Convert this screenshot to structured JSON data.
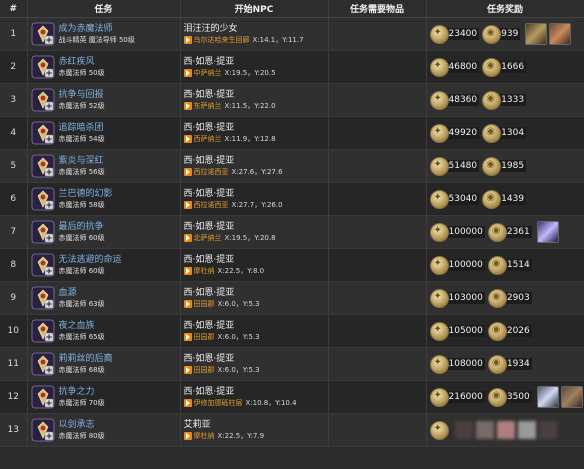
{
  "headers": {
    "num": "#",
    "quest": "任务",
    "npc": "开始NPC",
    "items": "任务需要物品",
    "rewards": "任务奖励"
  },
  "rows": [
    {
      "num": "1",
      "name": "成为赤魔法师",
      "sub": "战斗精英 魔法导师 50级",
      "npc": "泪汪汪的少女",
      "zone": "乌尔达哈来生回廊",
      "coords": "X:14.1，Y:11.7",
      "exp": "23400",
      "gil": "939",
      "items": [
        "a",
        "b"
      ]
    },
    {
      "num": "2",
      "name": "赤红疾风",
      "sub": "赤魔法师 50级",
      "npc": "西·如恩·提亚",
      "zone": "中萨纳兰",
      "coords": "X:19.5，Y:20.5",
      "exp": "46800",
      "gil": "1666",
      "items": []
    },
    {
      "num": "3",
      "name": "抗争与回报",
      "sub": "赤魔法师 52级",
      "npc": "西·如恩·提亚",
      "zone": "东萨纳兰",
      "coords": "X:11.5，Y:22.0",
      "exp": "48360",
      "gil": "1333",
      "items": []
    },
    {
      "num": "4",
      "name": "追踪暗杀团",
      "sub": "赤魔法师 54级",
      "npc": "西·如恩·提亚",
      "zone": "西萨纳兰",
      "coords": "X:11.9，Y:12.8",
      "exp": "49920",
      "gil": "1304",
      "items": []
    },
    {
      "num": "5",
      "name": "紫炎与深红",
      "sub": "赤魔法师 56级",
      "npc": "西·如恩·提亚",
      "zone": "西拉诺西亚",
      "coords": "X:27.6，Y:27.6",
      "exp": "51480",
      "gil": "1985",
      "items": []
    },
    {
      "num": "6",
      "name": "兰巴德的幻影",
      "sub": "赤魔法师 58级",
      "npc": "西·如恩·提亚",
      "zone": "西拉诺西亚",
      "coords": "X:27.7，Y:26.0",
      "exp": "53040",
      "gil": "1439",
      "items": []
    },
    {
      "num": "7",
      "name": "最后的抗争",
      "sub": "赤魔法师 60级",
      "npc": "西·如恩·提亚",
      "zone": "北萨纳兰",
      "coords": "X:19.5，Y:20.8",
      "exp": "100000",
      "gil": "2361",
      "items": [
        "c"
      ]
    },
    {
      "num": "8",
      "name": "无法逃避的命运",
      "sub": "赤魔法师 60级",
      "npc": "西·如恩·提亚",
      "zone": "摩杜纳",
      "coords": "X:22.5，Y:8.0",
      "exp": "100000",
      "gil": "1514",
      "items": []
    },
    {
      "num": "9",
      "name": "血源",
      "sub": "赤魔法师 63级",
      "npc": "西·如恩·提亚",
      "zone": "田园郡",
      "coords": "X:6.0，Y:5.3",
      "exp": "103000",
      "gil": "2903",
      "items": []
    },
    {
      "num": "10",
      "name": "夜之血族",
      "sub": "赤魔法师 65级",
      "npc": "西·如恩·提亚",
      "zone": "田园郡",
      "coords": "X:6.0，Y:5.3",
      "exp": "105000",
      "gil": "2026",
      "items": []
    },
    {
      "num": "11",
      "name": "莉莉丝的后裔",
      "sub": "赤魔法师 68级",
      "npc": "西·如恩·提亚",
      "zone": "田园郡",
      "coords": "X:6.0，Y:5.3",
      "exp": "108000",
      "gil": "1934",
      "items": []
    },
    {
      "num": "12",
      "name": "抗争之力",
      "sub": "赤魔法师 70级",
      "npc": "西·如恩·提亚",
      "zone": "伊修加德砥柱层",
      "coords": "X:10.8，Y:10.4",
      "exp": "216000",
      "gil": "3500",
      "items": [
        "d",
        "e"
      ]
    },
    {
      "num": "13",
      "name": "以剑承志",
      "sub": "赤魔法师 80级",
      "npc": "艾莉亚",
      "zone": "摩杜纳",
      "coords": "X:22.5，Y:7.9",
      "exp": "",
      "gil": "",
      "items": [],
      "blurred": true
    }
  ]
}
